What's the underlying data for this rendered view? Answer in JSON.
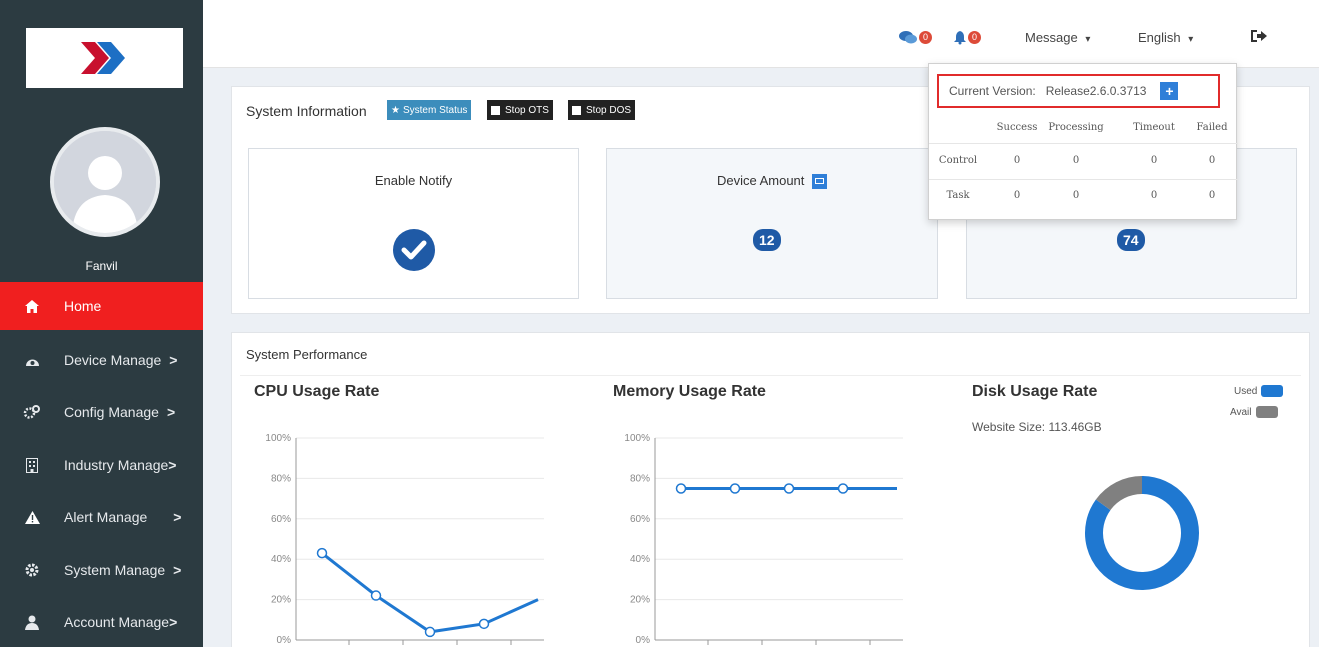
{
  "user": {
    "name": "Fanvil"
  },
  "sidebar": {
    "items": [
      {
        "label": "Home",
        "chevron": "",
        "icon": "home-icon",
        "active": true
      },
      {
        "label": "Device Manage",
        "chevron": ">",
        "icon": "dashboard-icon"
      },
      {
        "label": "Config Manage",
        "chevron": ">",
        "icon": "cogs-icon"
      },
      {
        "label": "Industry Manage",
        "chevron": ">",
        "icon": "building-icon"
      },
      {
        "label": "Alert Manage",
        "chevron": ">",
        "icon": "warning-icon"
      },
      {
        "label": "System Manage",
        "chevron": ">",
        "icon": "gear-icon"
      },
      {
        "label": "Account Manage",
        "chevron": ">",
        "icon": "users-icon"
      }
    ]
  },
  "header": {
    "comments_count": "0",
    "alerts_count": "0",
    "message_label": "Message",
    "language_label": "English",
    "caret": "▾"
  },
  "system_info": {
    "title": "System Information",
    "buttons": {
      "status": "System Status",
      "stop_ots": "Stop OTS",
      "stop_dos": "Stop DOS"
    },
    "enable_notify_label": "Enable Notify",
    "device_amount_label": "Device Amount",
    "device_amount": "12",
    "third_box_value": "74"
  },
  "message_dropdown": {
    "version_label": "Current Version:",
    "version_value": "Release2.6.0.3713",
    "plus": "+",
    "columns": [
      "Success",
      "Processing",
      "Timeout",
      "Failed"
    ],
    "rows": [
      {
        "name": "Control",
        "values": [
          "0",
          "0",
          "0",
          "0"
        ]
      },
      {
        "name": "Task",
        "values": [
          "0",
          "0",
          "0",
          "0"
        ]
      }
    ]
  },
  "performance": {
    "title": "System Performance"
  },
  "colors": {
    "sidebar_bg": "#2c3b41",
    "active_red": "#f01f1f",
    "accent_blue": "#1f78d1",
    "avail_gray": "#808080",
    "badge_blue": "#1f5aa6"
  },
  "chart_data": [
    {
      "type": "line",
      "title": "CPU Usage Rate",
      "yticks": [
        "100%",
        "80%",
        "60%",
        "40%",
        "20%",
        "0%"
      ],
      "ylim": [
        0,
        100
      ],
      "values": [
        43,
        22,
        4,
        8,
        20
      ]
    },
    {
      "type": "line",
      "title": "Memory Usage Rate",
      "yticks": [
        "100%",
        "80%",
        "60%",
        "40%",
        "20%",
        "0%"
      ],
      "ylim": [
        0,
        100
      ],
      "values": [
        75,
        75,
        75,
        75,
        75
      ]
    },
    {
      "type": "pie",
      "title": "Disk Usage Rate",
      "subtitle": "Website Size: 113.46GB",
      "labels": [
        "Used",
        "Avail"
      ],
      "values": [
        85,
        15
      ],
      "legend": "top-right"
    }
  ]
}
